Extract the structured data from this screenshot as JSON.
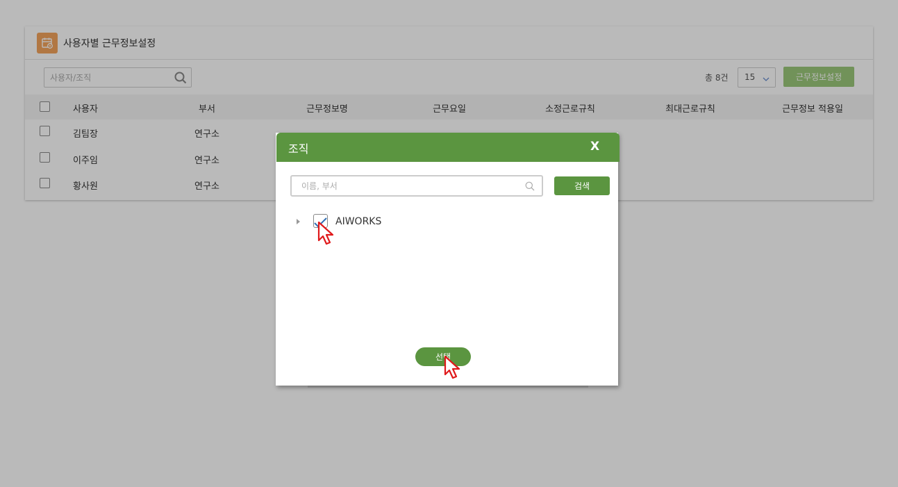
{
  "page": {
    "title": "사용자별 근무정보설정",
    "icon": "calendar-settings-icon",
    "accent_color": "#f3a35c"
  },
  "toolbar": {
    "search_placeholder": "사용자/조직",
    "total_label": "총 8건",
    "per_page_value": "15",
    "setting_button": "근무정보설정"
  },
  "table": {
    "headers": [
      "사용자",
      "부서",
      "근무정보명",
      "근무요일",
      "소정근로규칙",
      "최대근로규칙",
      "근무정보 적용일"
    ],
    "rows": [
      {
        "user": "김팀장",
        "dept": "연구소"
      },
      {
        "user": "이주임",
        "dept": "연구소"
      },
      {
        "user": "황사원",
        "dept": "연구소"
      }
    ]
  },
  "dialog": {
    "title": "조직",
    "close_label": "X",
    "search_placeholder": "이름, 부서",
    "search_button": "검색",
    "tree_root_label": "AIWORKS",
    "select_button": "선택",
    "header_color": "#5b9540"
  }
}
